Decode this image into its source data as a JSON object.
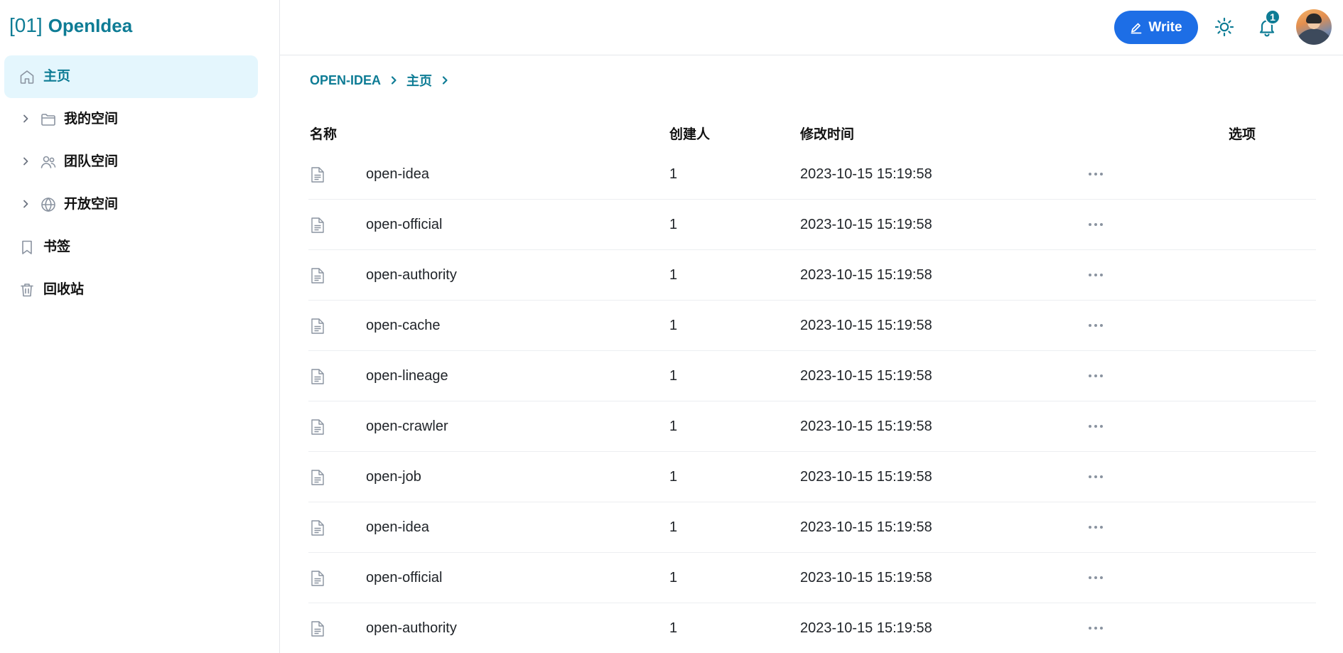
{
  "brand": {
    "prefix": "[01]",
    "name": "OpenIdea",
    "color": "#0e7c95"
  },
  "sidebar": {
    "items": [
      {
        "label": "主页",
        "icon": "home-icon",
        "active": true,
        "expandable": false
      },
      {
        "label": "我的空间",
        "icon": "folder-icon",
        "active": false,
        "expandable": true
      },
      {
        "label": "团队空间",
        "icon": "users-icon",
        "active": false,
        "expandable": true
      },
      {
        "label": "开放空间",
        "icon": "globe-icon",
        "active": false,
        "expandable": true
      },
      {
        "label": "书签",
        "icon": "bookmark-icon",
        "active": false,
        "expandable": false
      },
      {
        "label": "回收站",
        "icon": "trash-icon",
        "active": false,
        "expandable": false
      }
    ]
  },
  "topbar": {
    "write_label": "Write",
    "notification_count": "1",
    "write_color": "#1d6ee6"
  },
  "breadcrumb": [
    "OPEN-IDEA",
    "主页"
  ],
  "table": {
    "columns": [
      "名称",
      "创建人",
      "修改时间",
      "选项"
    ],
    "rows": [
      {
        "name": "open-idea",
        "creator": "1",
        "modified": "2023-10-15 15:19:58"
      },
      {
        "name": "open-official",
        "creator": "1",
        "modified": "2023-10-15 15:19:58"
      },
      {
        "name": "open-authority",
        "creator": "1",
        "modified": "2023-10-15 15:19:58"
      },
      {
        "name": "open-cache",
        "creator": "1",
        "modified": "2023-10-15 15:19:58"
      },
      {
        "name": "open-lineage",
        "creator": "1",
        "modified": "2023-10-15 15:19:58"
      },
      {
        "name": "open-crawler",
        "creator": "1",
        "modified": "2023-10-15 15:19:58"
      },
      {
        "name": "open-job",
        "creator": "1",
        "modified": "2023-10-15 15:19:58"
      },
      {
        "name": "open-idea",
        "creator": "1",
        "modified": "2023-10-15 15:19:58"
      },
      {
        "name": "open-official",
        "creator": "1",
        "modified": "2023-10-15 15:19:58"
      },
      {
        "name": "open-authority",
        "creator": "1",
        "modified": "2023-10-15 15:19:58"
      }
    ]
  }
}
